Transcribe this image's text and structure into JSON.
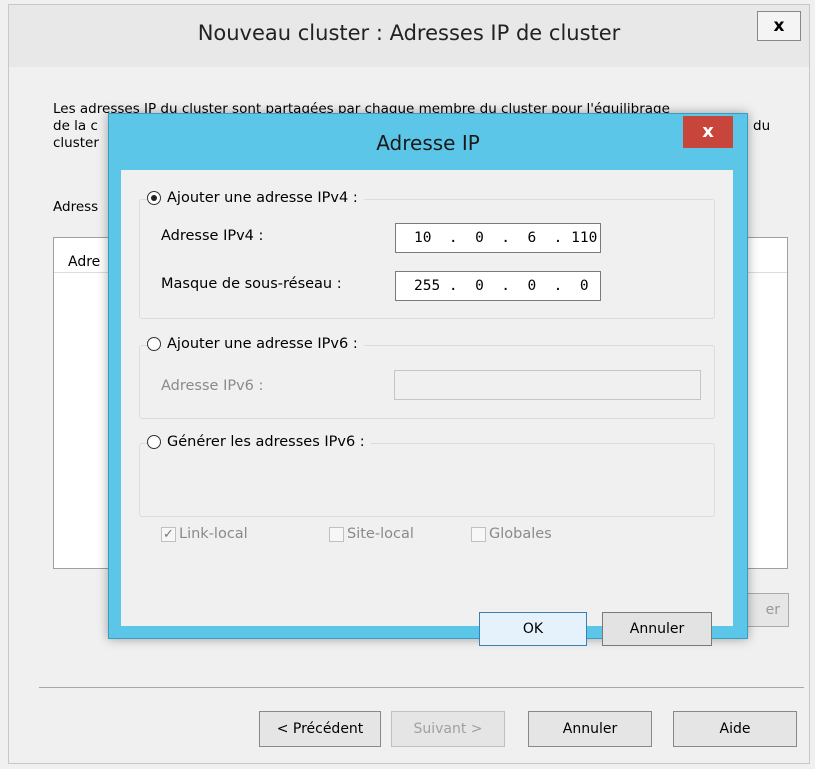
{
  "wizard": {
    "title": "Nouveau cluster : Adresses IP de cluster",
    "close_label": "x",
    "description_lines": [
      "Les adresses IP du cluster sont partagées par chaque membre du cluster pour l'équilibrage",
      "de la c",
      "cluster"
    ],
    "description_right": "du",
    "list_label": "Adress",
    "list_column": "Adre",
    "remove_label": "er",
    "buttons": {
      "previous": "< Précédent",
      "next": "Suivant >",
      "cancel": "Annuler",
      "help": "Aide"
    }
  },
  "dialog": {
    "title": "Adresse IP",
    "close_label": "x",
    "ipv4": {
      "option_label": "Ajouter une adresse IPv4 :",
      "selected": true,
      "address_label": "Adresse IPv4 :",
      "address_value": "10  .  0  .  6  . 110",
      "mask_label": "Masque de sous-réseau :",
      "mask_value": "255 .  0  .  0  .  0"
    },
    "ipv6": {
      "option_label": "Ajouter une adresse IPv6 :",
      "selected": false,
      "address_label": "Adresse IPv6 :",
      "address_value": ""
    },
    "generate": {
      "option_label": "Générer les adresses IPv6 :",
      "selected": false,
      "link_local_label": "Link-local",
      "link_local_checked": true,
      "site_local_label": "Site-local",
      "site_local_checked": false,
      "global_label": "Globales",
      "global_checked": false
    },
    "buttons": {
      "ok": "OK",
      "cancel": "Annuler"
    }
  },
  "colors": {
    "dialog_frame": "#5cc6e8",
    "close_button": "#c7453b"
  },
  "icons": {
    "checkmark": "check-icon"
  }
}
